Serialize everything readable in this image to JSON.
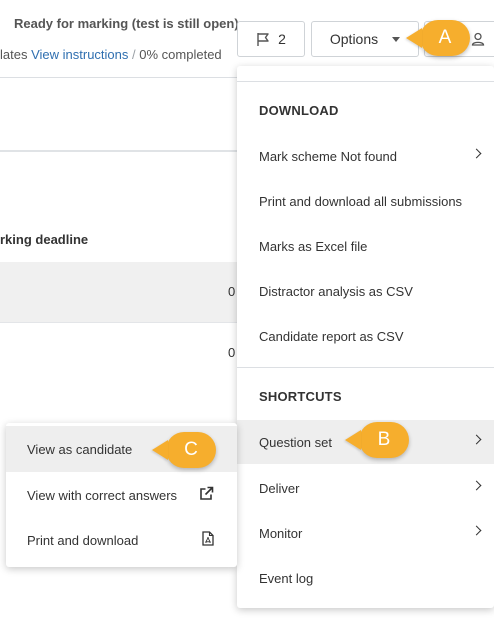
{
  "header": {
    "status": "Ready for marking (test is still open)",
    "updates_text": "lates",
    "view_instructions": "View instructions",
    "separator": "/",
    "progress": "0% completed"
  },
  "toolbar": {
    "flag_count": "2",
    "options_label": "Options"
  },
  "table": {
    "column_header": "rking deadline",
    "rows": [
      {
        "value": "0"
      },
      {
        "value": "0"
      }
    ]
  },
  "options_menu": {
    "download_heading": "DOWNLOAD",
    "download_items": [
      {
        "label": "Mark scheme Not found",
        "has_submenu": true
      },
      {
        "label": "Print and download all submissions",
        "has_submenu": false
      },
      {
        "label": "Marks as Excel file",
        "has_submenu": false
      },
      {
        "label": "Distractor analysis as CSV",
        "has_submenu": false
      },
      {
        "label": "Candidate report as CSV",
        "has_submenu": false
      }
    ],
    "shortcuts_heading": "SHORTCUTS",
    "shortcut_items": [
      {
        "label": "Question set",
        "has_submenu": true
      },
      {
        "label": "Deliver",
        "has_submenu": true
      },
      {
        "label": "Monitor",
        "has_submenu": true
      },
      {
        "label": "Event log",
        "has_submenu": false
      }
    ]
  },
  "question_set_submenu": {
    "items": [
      {
        "label": "View as candidate",
        "icon": "none"
      },
      {
        "label": "View with correct answers",
        "icon": "external-link-icon"
      },
      {
        "label": "Print and download",
        "icon": "pdf-file-icon"
      }
    ]
  },
  "callouts": {
    "a": "A",
    "b": "B",
    "c": "C"
  },
  "colors": {
    "link": "#2f6fb0",
    "callout": "#f6ae2d",
    "hover_bg": "#eeeeee"
  }
}
